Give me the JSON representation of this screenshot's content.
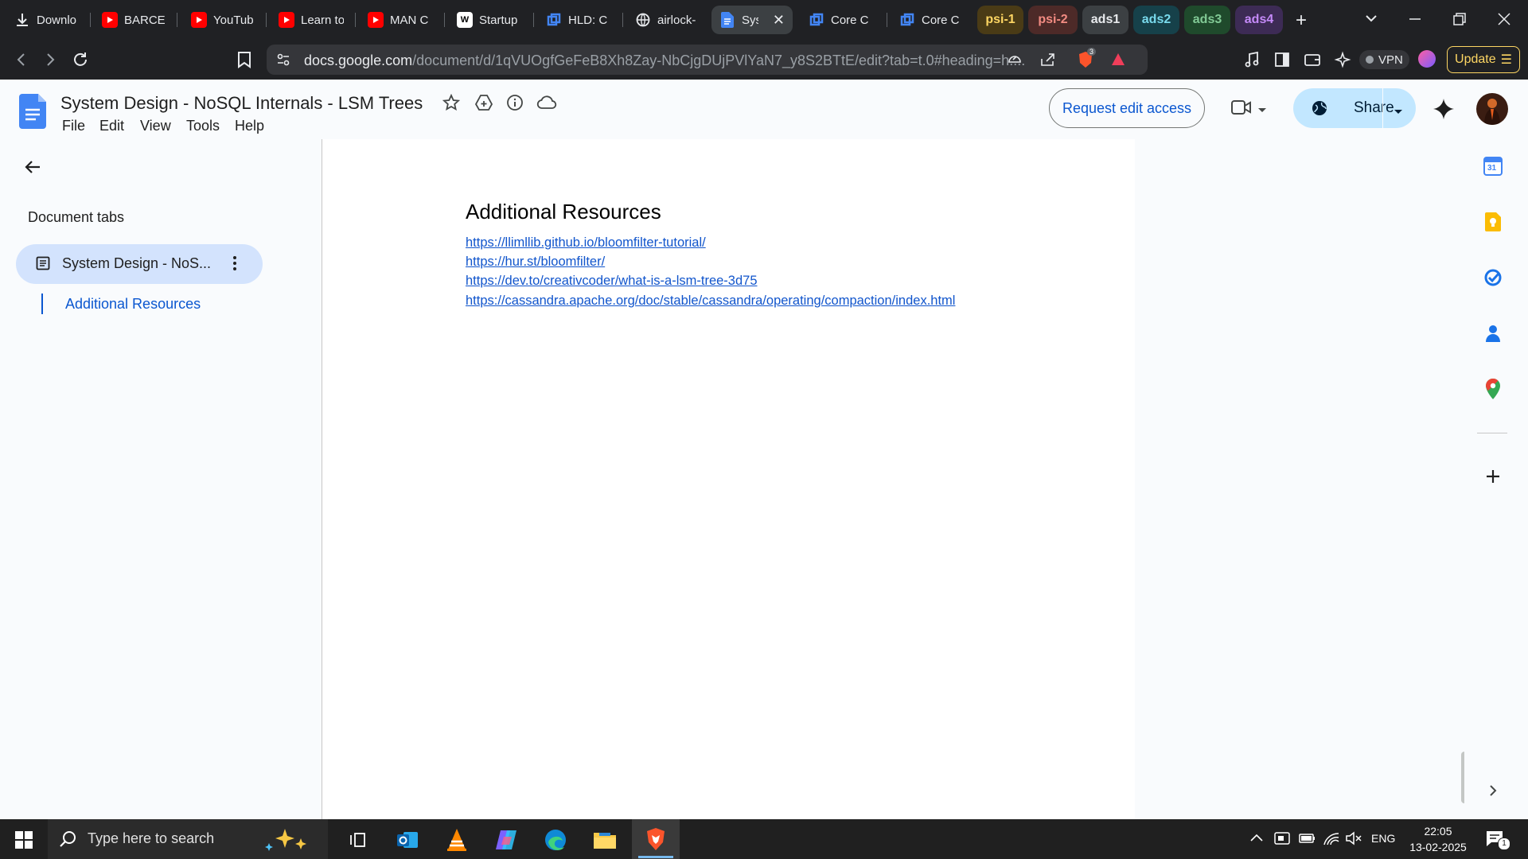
{
  "browser": {
    "tabs": [
      {
        "title": "Downlo",
        "icon": "download-icon"
      },
      {
        "title": "BARCEL",
        "icon": "youtube-icon"
      },
      {
        "title": "YouTub",
        "icon": "youtube-icon"
      },
      {
        "title": "Learn to",
        "icon": "youtube-icon"
      },
      {
        "title": "MAN C",
        "icon": "youtube-icon"
      },
      {
        "title": "Startup",
        "icon": "w-icon"
      },
      {
        "title": "HLD: C",
        "icon": "cube-icon"
      },
      {
        "title": "airlock-",
        "icon": "globe-icon"
      },
      {
        "title": "Sys",
        "icon": "docs-icon"
      },
      {
        "title": "Core C",
        "icon": "cube-icon"
      },
      {
        "title": "Core C",
        "icon": "cube-icon"
      }
    ],
    "tab_groups": [
      {
        "label": "psi-1",
        "bg": "#4a3b16",
        "fg": "#fdd663"
      },
      {
        "label": "psi-2",
        "bg": "#4d2a28",
        "fg": "#f28b82"
      },
      {
        "label": "ads1",
        "bg": "#3c4043",
        "fg": "#e8eaed"
      },
      {
        "label": "ads2",
        "bg": "#16414a",
        "fg": "#78d9ec"
      },
      {
        "label": "ads3",
        "bg": "#1f4a2c",
        "fg": "#81c995"
      },
      {
        "label": "ads4",
        "bg": "#3d2b55",
        "fg": "#c58af9"
      }
    ],
    "url_host": "docs.google.com",
    "url_path": "/document/d/1qVUOgfGeFeB8Xh8Zay-NbCjgDUjPVlYaN7_y8S2BTtE/edit?tab=t.0#heading=h....",
    "brave_badge": "3",
    "vpn_label": "VPN",
    "update_label": "Update"
  },
  "docs": {
    "title": "System Design - NoSQL Internals - LSM Trees",
    "menus": [
      "File",
      "Edit",
      "View",
      "Tools",
      "Help"
    ],
    "request_edit_label": "Request edit access",
    "share_label": "Share"
  },
  "sidebar": {
    "header": "Document tabs",
    "tab_label": "System Design - NoS...",
    "outline_item": "Additional Resources"
  },
  "document": {
    "heading": "Additional Resources",
    "links": [
      "https://llimllib.github.io/bloomfilter-tutorial/",
      "https://hur.st/bloomfilter/",
      "https://dev.to/creativcoder/what-is-a-lsm-tree-3d75",
      "https://cassandra.apache.org/doc/stable/cassandra/operating/compaction/index.html"
    ]
  },
  "siderail": {
    "calendar_day": "31"
  },
  "taskbar": {
    "search_placeholder": "Type here to search",
    "language": "ENG",
    "time": "22:05",
    "date": "13-02-2025",
    "notification_count": "1"
  }
}
